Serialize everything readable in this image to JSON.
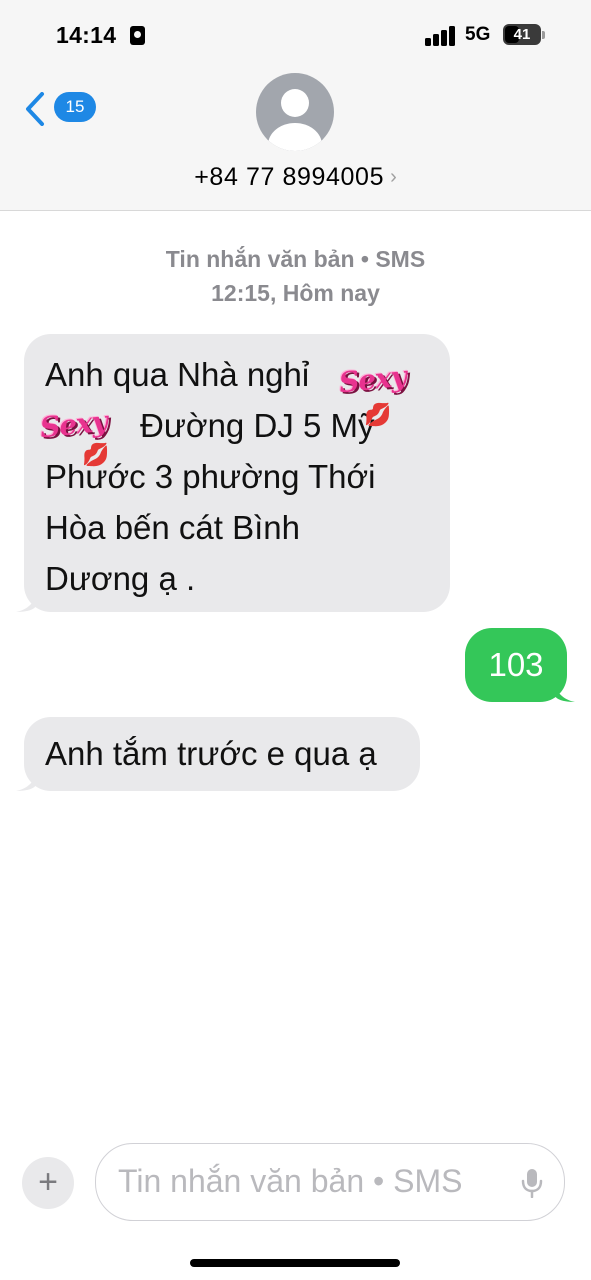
{
  "status_bar": {
    "time": "14:14",
    "network": "5G",
    "battery_level": "41",
    "battery_fraction": 0.41,
    "signal_bars": 4
  },
  "header": {
    "back_count": "15",
    "contact_name": "+84 77 8994005",
    "contact_chevron": "›",
    "avatar_icon": "person-silhouette-icon"
  },
  "thread": {
    "service_label": "Tin nhắn văn bản • SMS",
    "timestamp": "12:15, Hôm nay"
  },
  "messages": [
    {
      "direction": "incoming",
      "lines": [
        "Anh qua Nhà nghỉ",
        "Đường DJ 5 Mỹ",
        "Phước 3 phường Thới",
        "Hòa bến cát Bình",
        "Dương ạ ."
      ],
      "sticker_text": "Sexy"
    },
    {
      "direction": "outgoing",
      "text": "103"
    },
    {
      "direction": "incoming",
      "text": "Anh tắm trước e qua ạ"
    }
  ],
  "compose": {
    "placeholder": "Tin nhắn văn bản • SMS",
    "plus_label": "+",
    "mic_icon": "microphone-icon"
  },
  "colors": {
    "incoming_bubble": "#e9e9eb",
    "outgoing_bubble": "#34c759",
    "badge": "#1e88e5"
  }
}
